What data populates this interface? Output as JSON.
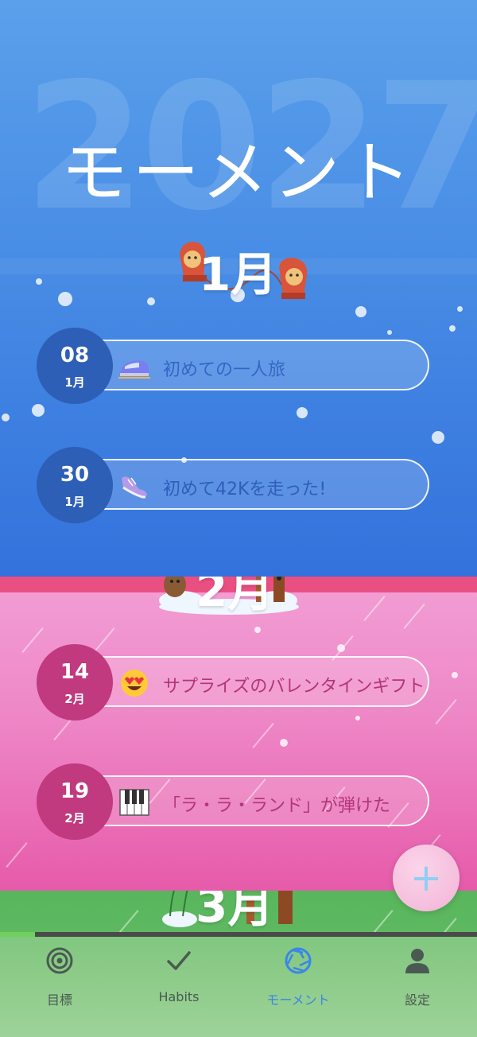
{
  "header": {
    "year": "2027",
    "title": "モーメント"
  },
  "months": [
    {
      "label": "1月"
    },
    {
      "label": "2月"
    },
    {
      "label": "3月"
    }
  ],
  "moments": [
    {
      "day": "08",
      "month": "1月",
      "icon": "bullet-train-icon",
      "text": "初めての一人旅",
      "text_color": "#3566c4",
      "circle_color": "#2d5fb7"
    },
    {
      "day": "30",
      "month": "1月",
      "icon": "sneaker-icon",
      "text": "初めて42Kを走った!",
      "text_color": "#2f5eb8",
      "circle_color": "#2d5fb7"
    },
    {
      "day": "14",
      "month": "2月",
      "icon": "heart-eyes-icon",
      "text": "サプライズのバレンタインギフト",
      "text_color": "#b33478",
      "circle_color": "#c1397f"
    },
    {
      "day": "19",
      "month": "2月",
      "icon": "piano-keys-icon",
      "text": "「ラ・ラ・ランド」が弾けた",
      "text_color": "#b33478",
      "circle_color": "#c1397f"
    }
  ],
  "fab": {
    "symbol": "+",
    "icon": "plus-icon"
  },
  "nav": {
    "items": [
      {
        "label": "目標",
        "icon": "target-icon",
        "active": false
      },
      {
        "label": "Habits",
        "icon": "check-icon",
        "active": false
      },
      {
        "label": "モーメント",
        "icon": "aperture-icon",
        "active": true
      },
      {
        "label": "設定",
        "icon": "person-icon",
        "active": false
      }
    ],
    "active_color": "#3a86e8",
    "progress": 0.07
  }
}
